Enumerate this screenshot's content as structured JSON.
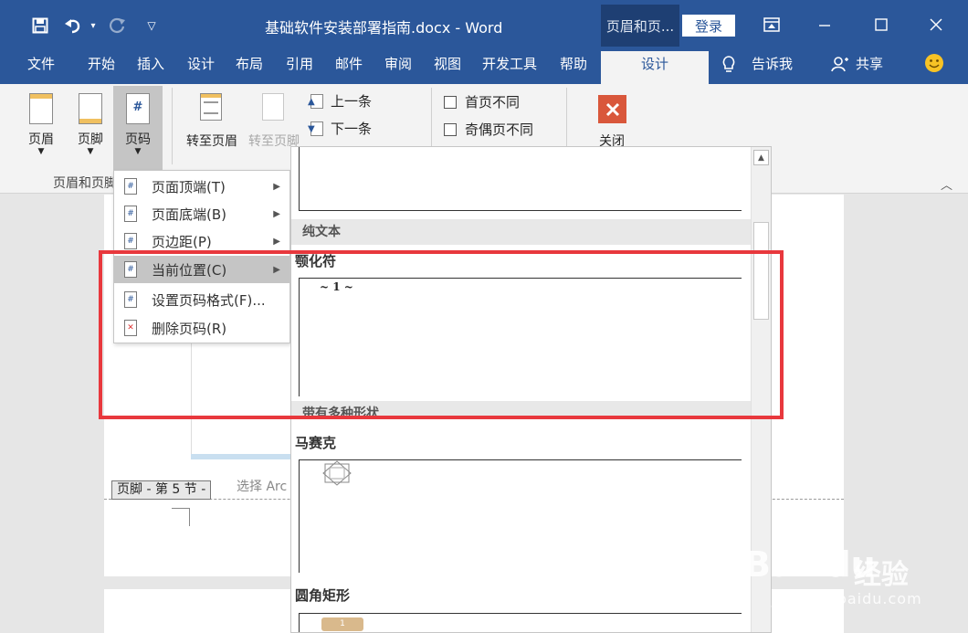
{
  "window": {
    "title": "基础软件安装部署指南.docx - Word",
    "context_tab": "页眉和页...",
    "login": "登录",
    "qat_icons": [
      "save-icon",
      "undo-icon",
      "redo-icon",
      "customize-icon"
    ],
    "controls": [
      "ribbon-display-icon",
      "minimize-icon",
      "maximize-icon",
      "close-icon"
    ]
  },
  "tabs": [
    "文件",
    "开始",
    "插入",
    "设计",
    "布局",
    "引用",
    "邮件",
    "审阅",
    "视图",
    "开发工具",
    "帮助",
    "设计"
  ],
  "active_tab": "设计",
  "tell_me": "告诉我",
  "share": "共享",
  "ribbon": {
    "header": "页眉",
    "footer": "页脚",
    "page_number": "页码",
    "goto_header": "转至页眉",
    "goto_footer": "转至页脚",
    "previous": "上一条",
    "next": "下一条",
    "first_page_diff": "首页不同",
    "odd_even_diff": "奇偶页不同",
    "close": "关闭",
    "group_label": "页眉和页脚"
  },
  "page_number_menu": [
    {
      "label": "页面顶端(T)",
      "submenu": true
    },
    {
      "label": "页面底端(B)",
      "submenu": true
    },
    {
      "label": "页边距(P)",
      "submenu": true
    },
    {
      "label": "当前位置(C)",
      "submenu": true,
      "highlighted": true
    },
    {
      "label": "设置页码格式(F)...",
      "submenu": false
    },
    {
      "label": "删除页码(R)",
      "submenu": false
    }
  ],
  "gallery": {
    "category_plain": "纯文本",
    "item_tilde": "颚化符",
    "tilde_sample": "~ 1 ~",
    "category_shapes": "带有多种形状",
    "item_mosaic": "马赛克",
    "item_rounded": "圆角矩形",
    "rounded_sample": "1"
  },
  "document": {
    "footer_tag": "页脚 - 第 5 节 -",
    "hint": "选择 Arc"
  },
  "watermark": {
    "brand": "Bai",
    "brand2": "du",
    "suffix": "经验",
    "url": "jingyan.baidu.com"
  },
  "colors": {
    "accent": "#2b579a",
    "highlight_box": "#e8383d",
    "close_button": "#d9573b"
  }
}
